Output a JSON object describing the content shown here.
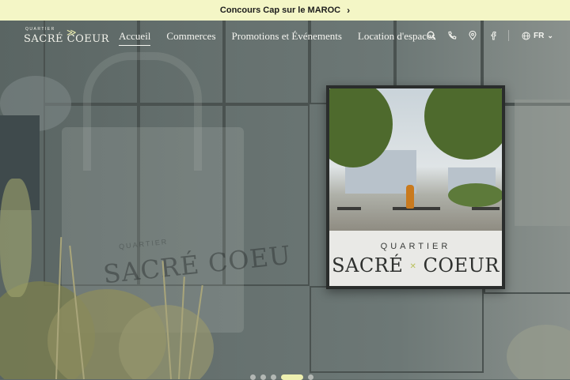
{
  "announcement": {
    "text": "Concours Cap sur le MAROC",
    "icon": "chevron-right-icon"
  },
  "brand": {
    "small": "QUARTIER",
    "name": "SACRÉ COEUR"
  },
  "nav": {
    "links": [
      {
        "label": "Accueil",
        "active": true
      },
      {
        "label": "Commerces",
        "active": false
      },
      {
        "label": "Promotions et Événements",
        "active": false
      },
      {
        "label": "Location d'espaces",
        "active": false
      }
    ],
    "icons": [
      "search-icon",
      "phone-icon",
      "location-pin-icon",
      "facebook-icon"
    ],
    "language": "FR"
  },
  "hero": {
    "poster_subtitle": "QUARTIER",
    "poster_title_left": "SACRÉ",
    "poster_title_right": "COEUR",
    "bag_text": "SACRÉ COEU",
    "bag_subtext": "QUARTIER"
  },
  "slider": {
    "count": 5,
    "active_index": 3
  },
  "colors": {
    "accent": "#eef0b0",
    "announce_bg": "#f4f6c6"
  }
}
